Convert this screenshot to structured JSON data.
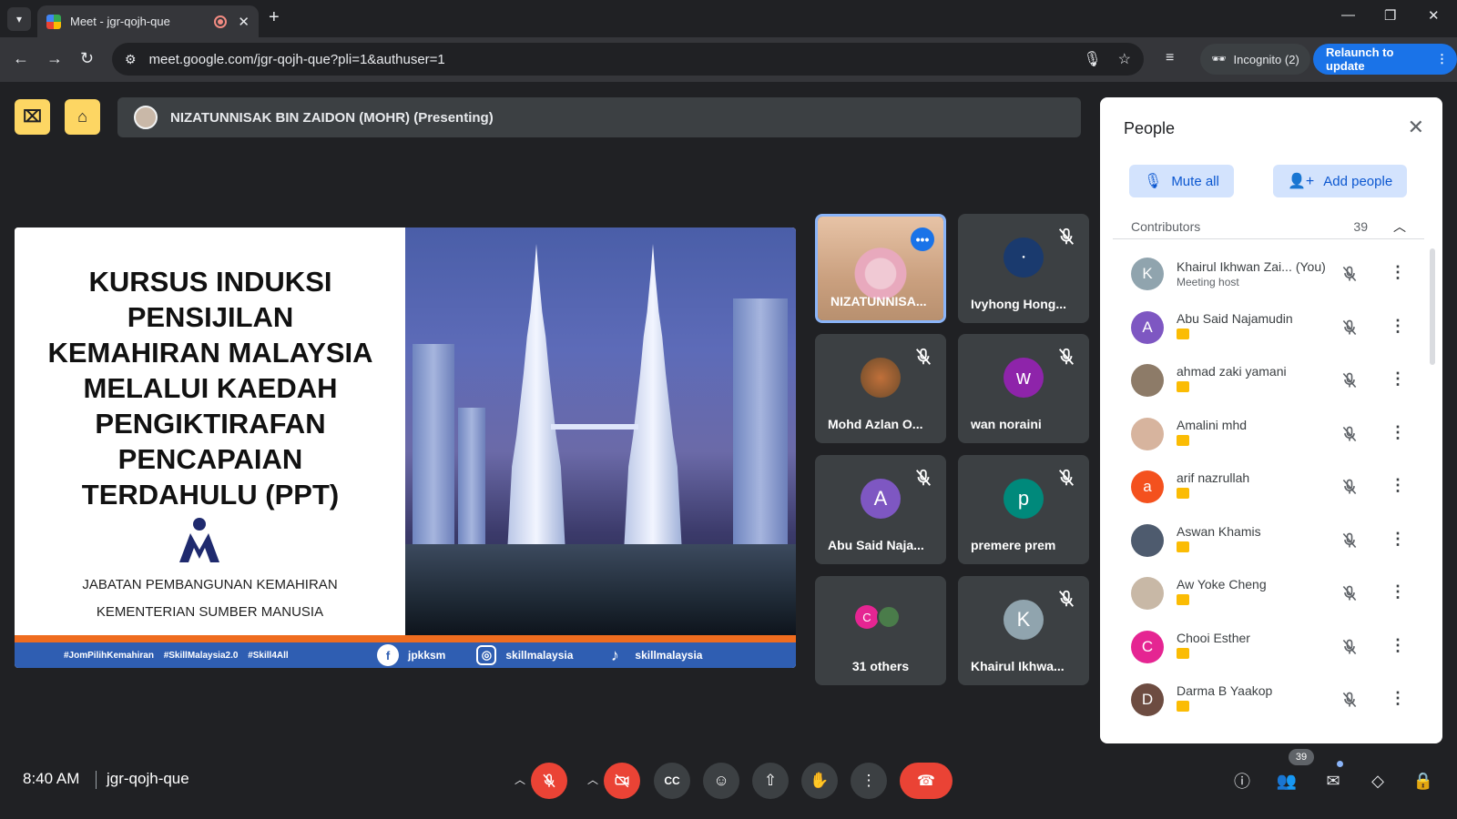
{
  "browser": {
    "tab_title": "Meet - jgr-qojh-que",
    "url": "meet.google.com/jgr-qojh-que?pli=1&authuser=1",
    "incognito_label": "Incognito (2)",
    "relaunch_label": "Relaunch to update"
  },
  "presenting": {
    "label": "NIZATUNNISAK BIN ZAIDON (MOHR) (Presenting)"
  },
  "slide": {
    "title_lines": [
      "KURSUS INDUKSI",
      "PENSIJILAN",
      "KEMAHIRAN MALAYSIA",
      "MELALUI KAEDAH",
      "PENGIKTIRAFAN",
      "PENCAPAIAN",
      "TERDAHULU (PPT)"
    ],
    "dept_line1": "JABATAN PEMBANGUNAN KEMAHIRAN",
    "dept_line2": "KEMENTERIAN SUMBER MANUSIA",
    "hashtags": "#JomPilihKemahiran #SkillMalaysia2.0 #Skill4All",
    "facebook": "jpkksm",
    "instagram": "skillmalaysia",
    "tiktok": "skillmalaysia"
  },
  "tiles": [
    {
      "name": "NIZATUNNISA...",
      "initial": "",
      "color": ""
    },
    {
      "name": "Ivyhong Hong...",
      "initial": "",
      "color": "#1a3a6e"
    },
    {
      "name": "Mohd Azlan O...",
      "initial": "",
      "color": ""
    },
    {
      "name": "wan noraini",
      "initial": "w",
      "color": "#8e24aa"
    },
    {
      "name": "Abu Said Naja...",
      "initial": "A",
      "color": "#7e57c2"
    },
    {
      "name": "premere prem",
      "initial": "p",
      "color": "#00897b"
    },
    {
      "name": "31 others",
      "initial": "C",
      "color": "#e52592"
    },
    {
      "name": "Khairul Ikhwa...",
      "initial": "K",
      "color": "#90a4ae"
    }
  ],
  "people": {
    "title": "People",
    "mute_all": "Mute all",
    "add_people": "Add people",
    "section": "Contributors",
    "section_count": "39",
    "list": [
      {
        "name": "Khairul Ikhwan Zai...",
        "suffix": "(You)",
        "sub": "Meeting host",
        "initial": "K",
        "color": "#90a4ae"
      },
      {
        "name": "Abu Said Najamudin",
        "suffix": "",
        "sub": "",
        "initial": "A",
        "color": "#7e57c2"
      },
      {
        "name": "ahmad zaki yamani",
        "suffix": "",
        "sub": "",
        "initial": "",
        "color": "#8d7b68"
      },
      {
        "name": "Amalini mhd",
        "suffix": "",
        "sub": "",
        "initial": "",
        "color": "#d7b49e"
      },
      {
        "name": "arif nazrullah",
        "suffix": "",
        "sub": "",
        "initial": "a",
        "color": "#f4511e"
      },
      {
        "name": "Aswan Khamis",
        "suffix": "",
        "sub": "",
        "initial": "",
        "color": "#4e5b6e"
      },
      {
        "name": "Aw Yoke Cheng",
        "suffix": "",
        "sub": "",
        "initial": "",
        "color": "#c8b8a6"
      },
      {
        "name": "Chooi Esther",
        "suffix": "",
        "sub": "",
        "initial": "C",
        "color": "#e52592"
      },
      {
        "name": "Darma B Yaakop",
        "suffix": "",
        "sub": "",
        "initial": "D",
        "color": "#6d4c41"
      }
    ]
  },
  "bottom": {
    "time": "8:40 AM",
    "meeting_code": "jgr-qojh-que",
    "people_count": "39"
  }
}
